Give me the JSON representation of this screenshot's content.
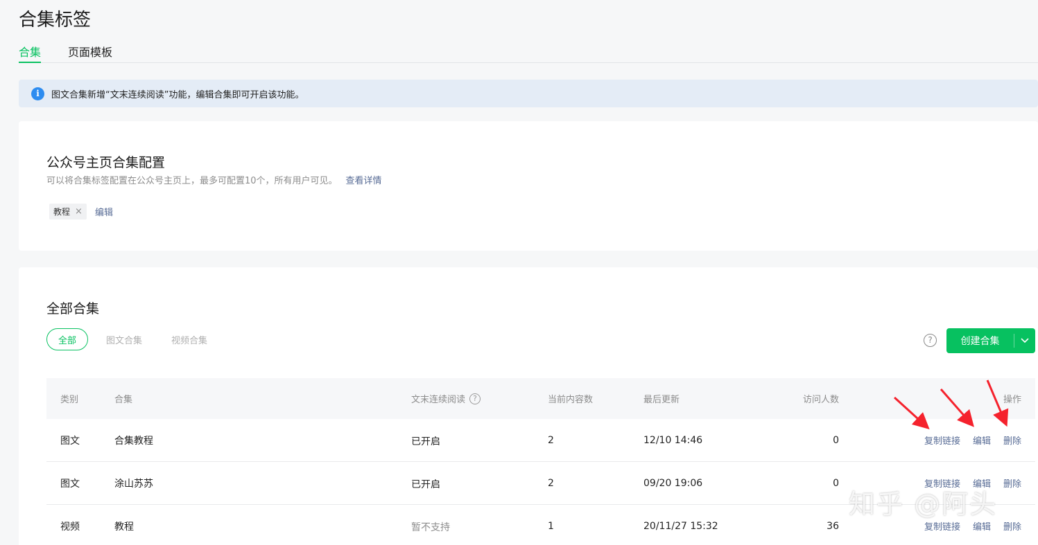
{
  "page": {
    "title": "合集标签"
  },
  "tabs": [
    {
      "label": "合集",
      "active": true
    },
    {
      "label": "页面模板",
      "active": false
    }
  ],
  "notice": {
    "icon": "info-icon",
    "text": "图文合集新增“文末连续阅读”功能，编辑合集即可开启该功能。"
  },
  "homepage_config": {
    "title": "公众号主页合集配置",
    "desc": "可以将合集标签配置在公众号主页上，最多可配置10个，所有用户可见。",
    "details_link": "查看详情",
    "tags": [
      {
        "label": "教程",
        "close": "×"
      }
    ],
    "edit_label": "编辑"
  },
  "all_collections": {
    "title": "全部合集",
    "filters": [
      {
        "label": "全部",
        "active": true
      },
      {
        "label": "图文合集",
        "active": false
      },
      {
        "label": "视频合集",
        "active": false
      }
    ],
    "help_icon": "?",
    "create_button": {
      "label": "创建合集",
      "dropdown_icon": "chevron-down-icon"
    },
    "columns": {
      "type": "类别",
      "name": "合集",
      "continuous_read": "文末连续阅读",
      "continuous_read_help": "?",
      "count": "当前内容数",
      "last_update": "最后更新",
      "visits": "访问人数",
      "ops": "操作"
    },
    "rows": [
      {
        "type": "图文",
        "name": "合集教程",
        "continuous_read": "已开启",
        "count": "2",
        "last_update": "12/10 14:46",
        "visits": "0",
        "ops": [
          "复制链接",
          "编辑",
          "删除"
        ]
      },
      {
        "type": "图文",
        "name": "涂山苏苏",
        "continuous_read": "已开启",
        "count": "2",
        "last_update": "09/20 19:06",
        "visits": "0",
        "ops": [
          "复制链接",
          "编辑",
          "删除"
        ]
      },
      {
        "type": "视频",
        "name": "教程",
        "continuous_read": "暂不支持",
        "count": "1",
        "last_update": "20/11/27 15:32",
        "visits": "36",
        "ops": [
          "复制链接",
          "编辑",
          "删除"
        ]
      }
    ]
  },
  "watermark": "知乎 @阿头",
  "colors": {
    "accent": "#07c160",
    "link": "#576b95",
    "annotation_arrow": "#f5222d"
  }
}
